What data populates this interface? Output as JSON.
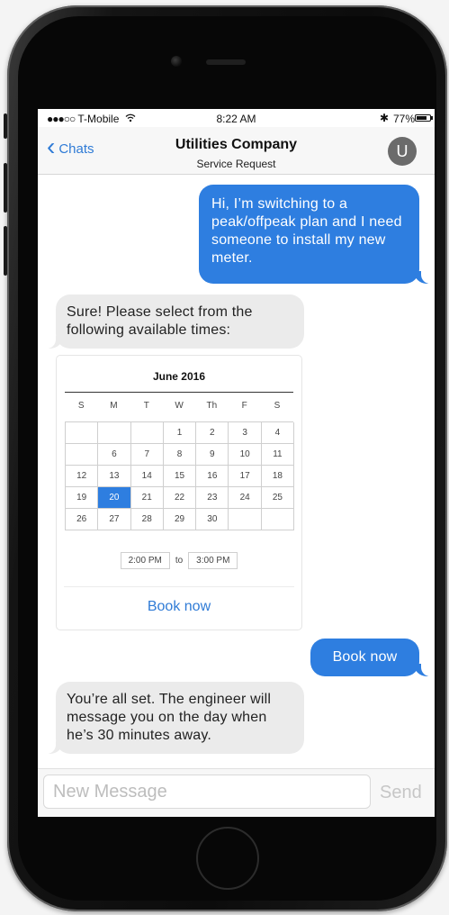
{
  "status_bar": {
    "carrier": "T-Mobile",
    "signal_icon": "●●●○○",
    "wifi_icon": "wifi-icon",
    "time": "8:22 AM",
    "bluetooth_icon": "✱",
    "battery_percent": "77%",
    "battery_level": 0.77
  },
  "nav": {
    "back_label": "Chats",
    "back_chevron": "‹",
    "title": "Utilities Company",
    "subtitle": "Service Request",
    "avatar_initial": "U"
  },
  "messages": {
    "m1": "Hi, I’m switching to a peak/offpeak plan and I need someone to install my new meter.",
    "m2": "Sure! Please select from the following available times:",
    "m3": "Book now",
    "m4": "You’re all set. The engineer will message you on the day when he’s 30 minutes away."
  },
  "calendar": {
    "month": "June 2016",
    "weekdays": [
      "S",
      "M",
      "T",
      "W",
      "Th",
      "F",
      "S"
    ],
    "weeks": [
      [
        "",
        "",
        "",
        "1",
        "2",
        "3",
        "4"
      ],
      [
        "",
        "6",
        "7",
        "8",
        "9",
        "10",
        "11"
      ],
      [
        "12",
        "13",
        "14",
        "15",
        "16",
        "17",
        "18"
      ],
      [
        "19",
        "20",
        "21",
        "22",
        "23",
        "24",
        "25"
      ],
      [
        "26",
        "27",
        "28",
        "29",
        "30",
        "",
        ""
      ]
    ],
    "selected_day": "20",
    "start_time": "2:00 PM",
    "separator": "to",
    "end_time": "3:00 PM",
    "book_button": "Book now"
  },
  "composer": {
    "placeholder": "New Message",
    "send_label": "Send"
  },
  "colors": {
    "accent": "#2e7ee0",
    "link": "#2f7bd6",
    "incoming_bubble": "#ebebeb"
  }
}
